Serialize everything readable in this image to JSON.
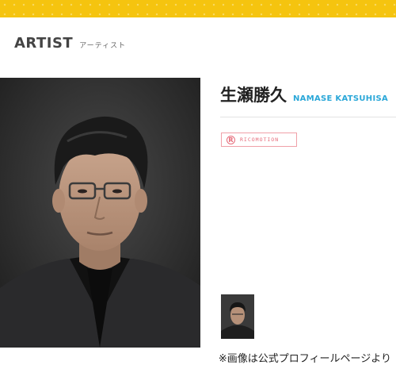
{
  "header": {
    "section_title": "ARTIST",
    "section_subtitle": "アーティスト"
  },
  "artist": {
    "name_jp": "生瀬勝久",
    "name_en": "NAMASE KATSUHISA",
    "label_icon": "R",
    "label_name": "RICOMOTION",
    "photo_icon": "portrait-photo",
    "thumbnail_icon": "portrait-thumbnail"
  },
  "caption": "※画像は公式プロフィールページより",
  "colors": {
    "topbar": "#f5c40f",
    "accent_blue": "#2aa7d8",
    "label_pink": "#e66b7a"
  }
}
